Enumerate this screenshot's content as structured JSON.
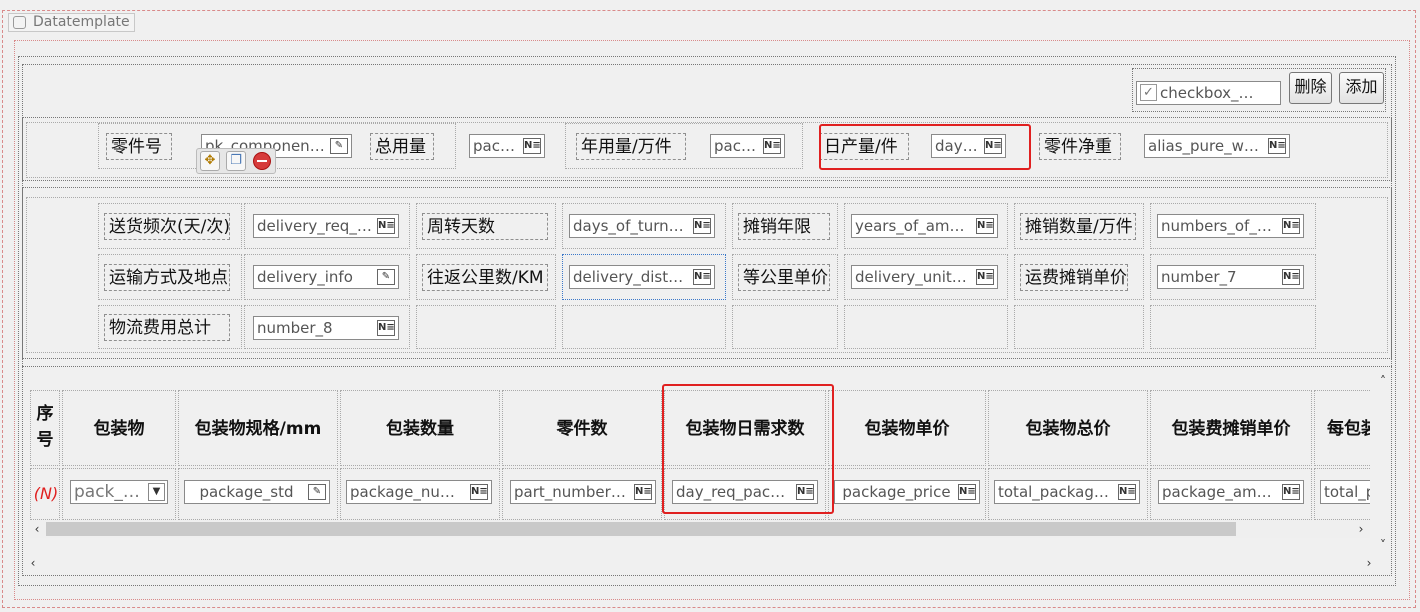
{
  "datatemplate_label": "Datatemplate",
  "toolbar": {
    "checkbox_field": "checkbox_selec...",
    "delete_label": "删除",
    "add_label": "添加"
  },
  "row1": {
    "part_no_label": "零件号",
    "part_no_value": "pk_component...",
    "total_usage_label": "总用量",
    "total_usage_value": "pack...",
    "annual_usage_label": "年用量/万件",
    "annual_usage_value": "pack...",
    "daily_output_label": "日产量/件",
    "daily_output_value": "day_...",
    "net_weight_label": "零件净重",
    "net_weight_value": "alias_pure_wei..."
  },
  "form2": {
    "r1": [
      {
        "label": "送货频次(天/次)",
        "value": "delivery_req_p..."
      },
      {
        "label": "周转天数",
        "value": "days_of_turno..."
      },
      {
        "label": "摊销年限",
        "value": "years_of_amor..."
      },
      {
        "label": "摊销数量/万件",
        "value": "numbers_of_a..."
      }
    ],
    "r2": [
      {
        "label": "运输方式及地点",
        "value": "delivery_info"
      },
      {
        "label": "往返公里数/KM",
        "value": "delivery_distance"
      },
      {
        "label": "等公里单价",
        "value": "delivery_unit_p..."
      },
      {
        "label": "运费摊销单价",
        "value": "number_7"
      }
    ],
    "r3": [
      {
        "label": "物流费用总计",
        "value": "number_8"
      }
    ]
  },
  "table": {
    "headers": [
      "序号",
      "包装物",
      "包装物规格/mm",
      "包装数量",
      "零件数",
      "包装物日需求数",
      "包装物单价",
      "包装物总价",
      "包装费摊销单价",
      "每包装"
    ],
    "seq_header_top": "序",
    "seq_header_bottom": "号",
    "row": {
      "seq": "(N)",
      "cells": [
        "pack_t...",
        "package_std",
        "package_number",
        "part_numbers_...",
        "day_req_packa...",
        "package_price",
        "total_package_...",
        "package_amort...",
        "total_p"
      ]
    }
  },
  "colors": {
    "highlight": "#e02020",
    "seq_text": "#e02020"
  }
}
